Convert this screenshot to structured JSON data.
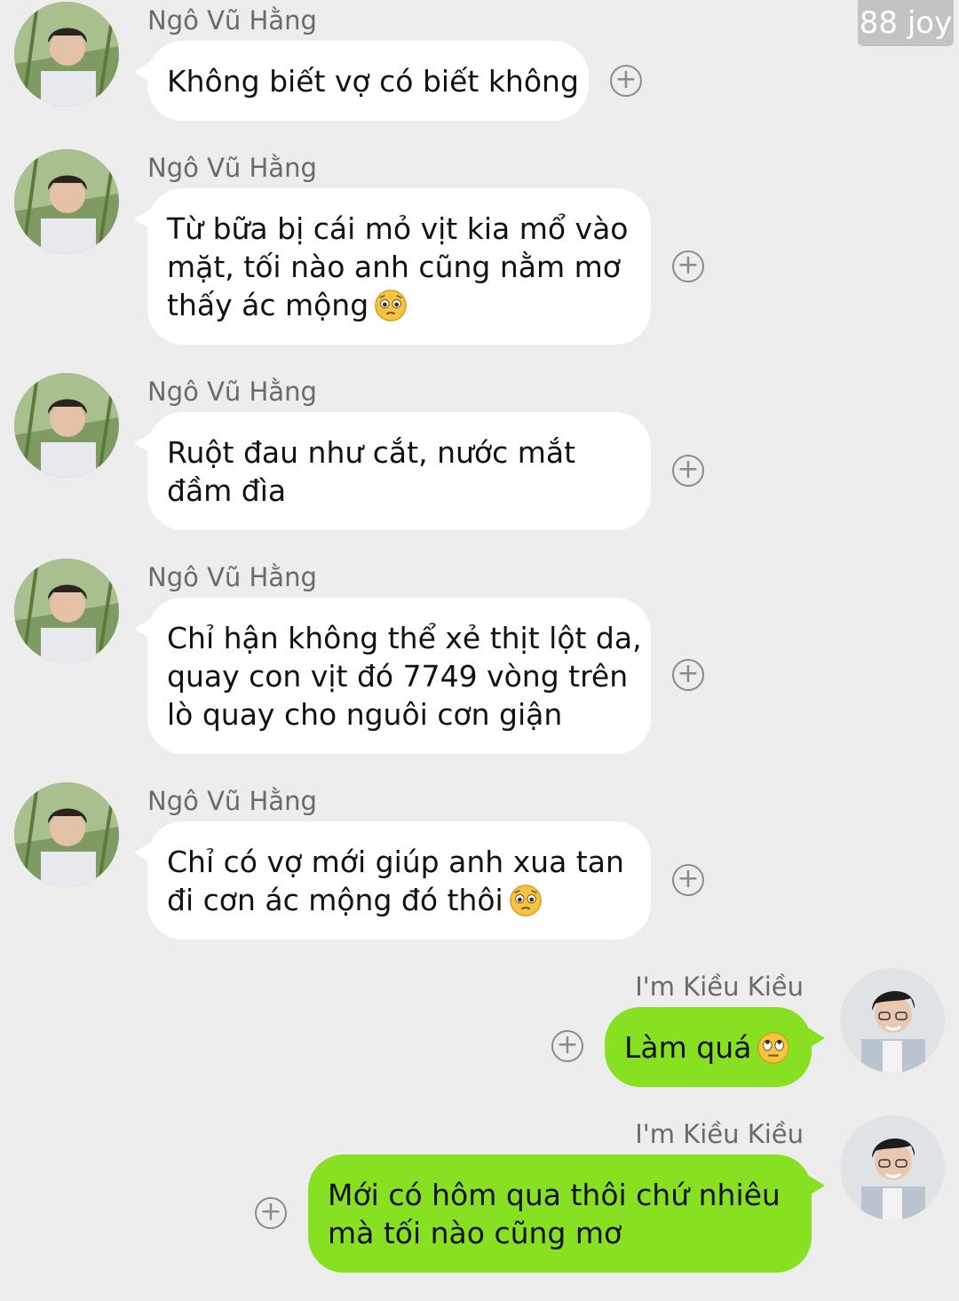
{
  "watermark": "88 joy",
  "messages": [
    {
      "sender": "Ngô Vũ Hằng",
      "lines": [
        "Không biết vợ có biết không"
      ],
      "emoji": ""
    },
    {
      "sender": "Ngô Vũ Hằng",
      "lines": [
        "Từ bữa bị cái mỏ vịt kia mổ vào",
        "mặt, tối nào anh cũng nằm mơ",
        "thấy ác mộng"
      ],
      "emoji": "pleading-face-icon"
    },
    {
      "sender": "Ngô Vũ Hằng",
      "lines": [
        "Ruột đau như cắt, nước mắt",
        "đầm đìa"
      ],
      "emoji": ""
    },
    {
      "sender": "Ngô Vũ Hằng",
      "lines": [
        "Chỉ hận không thể xẻ thịt lột da,",
        "quay con vịt đó 7749 vòng trên",
        "lò quay cho nguôi cơn giận"
      ],
      "emoji": ""
    },
    {
      "sender": "Ngô Vũ Hằng",
      "lines": [
        "Chỉ có vợ mới giúp anh xua tan",
        "đi cơn ác mộng đó thôi"
      ],
      "emoji": "pleading-face-icon"
    },
    {
      "sender": "I'm Kiều Kiều",
      "lines": [
        "Làm quá"
      ],
      "emoji": "eye-roll-face-icon"
    },
    {
      "sender": "I'm Kiều Kiều",
      "lines": [
        "Mới có hôm qua thôi chứ nhiêu",
        "mà tối nào cũng mơ"
      ],
      "emoji": ""
    }
  ],
  "plus_symbol": "+",
  "colors": {
    "background": "#ededed",
    "incoming_bubble": "#ffffff",
    "outgoing_bubble": "#87e022"
  }
}
